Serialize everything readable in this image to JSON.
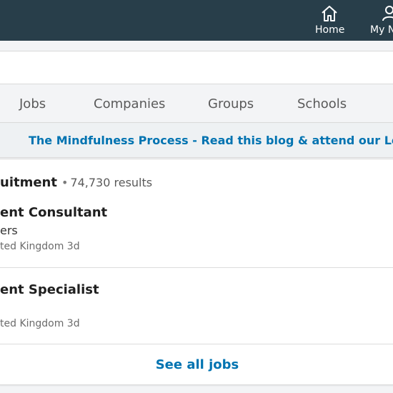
{
  "nav": {
    "items": [
      {
        "label": "Home",
        "icon": "home-icon"
      },
      {
        "label": "My N",
        "icon": "person-icon"
      }
    ]
  },
  "search": {
    "value": ""
  },
  "tabs": [
    "Jobs",
    "Companies",
    "Groups",
    "Schools"
  ],
  "banner": {
    "text": "The Mindfulness Process - Read this blog & attend our London"
  },
  "results": {
    "title": "uitment",
    "separator": "•",
    "count": "74,730 results",
    "jobs": [
      {
        "title": "ent Consultant",
        "company": "ers",
        "meta": "ted Kingdom 3d"
      },
      {
        "title": "ent Specialist",
        "company": "",
        "meta": "ted Kingdom 3d"
      }
    ],
    "see_all": "See all jobs"
  },
  "colors": {
    "nav_bg": "#283e4a",
    "link": "#0073b1",
    "page_bg": "#f3f4f6"
  }
}
